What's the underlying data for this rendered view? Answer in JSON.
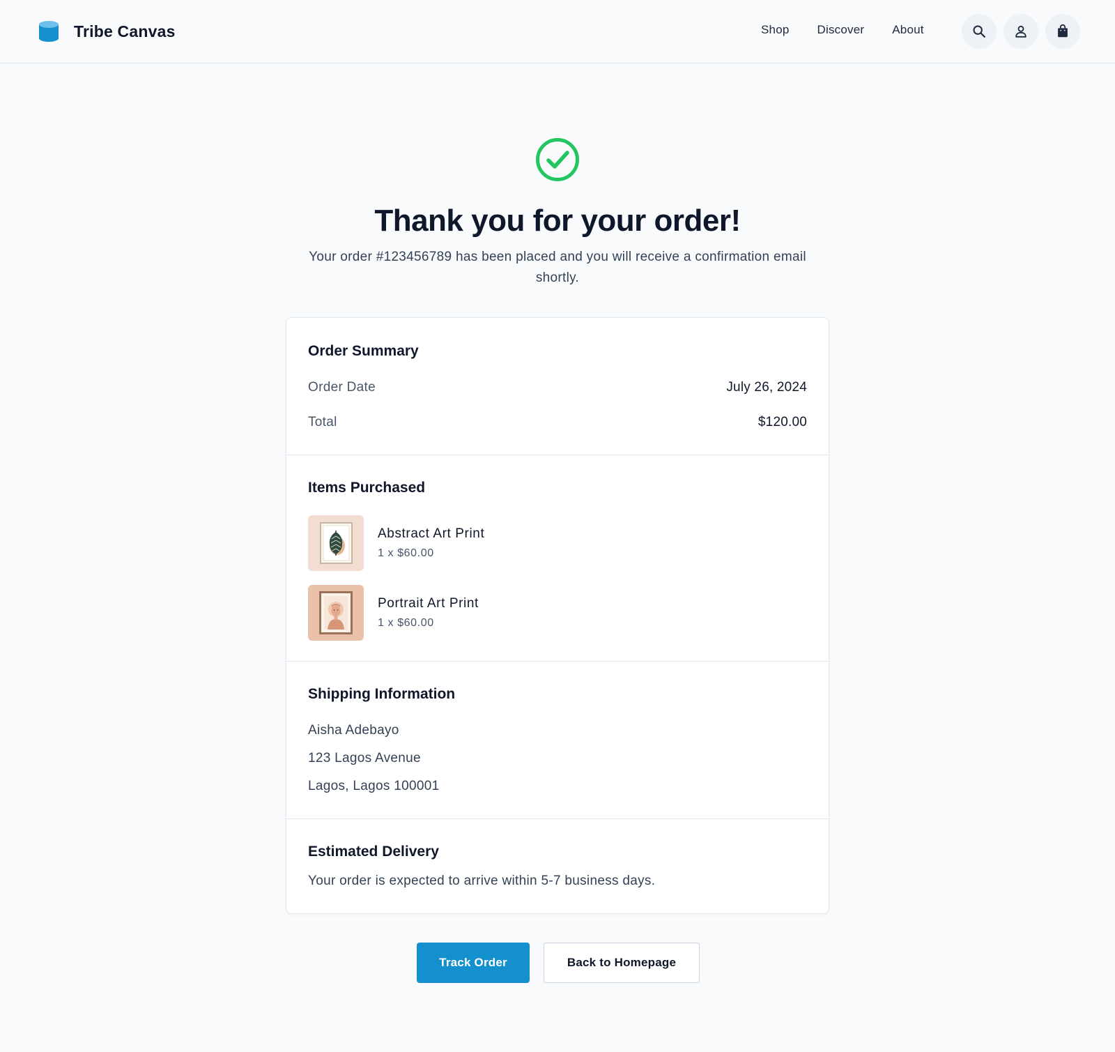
{
  "brand": {
    "name": "Tribe Canvas",
    "logo_icon": "cylinder-logo-icon",
    "accent_color": "#1590cf"
  },
  "nav": {
    "links": [
      "Shop",
      "Discover",
      "About"
    ],
    "icons": [
      "search-icon",
      "user-icon",
      "shopping-bag-icon"
    ]
  },
  "confirmation": {
    "icon": "check-circle-icon",
    "icon_color": "#22c55e",
    "title": "Thank you for your order!",
    "message": "Your order #123456789 has been placed and you will receive a confirmation email shortly."
  },
  "order_summary": {
    "heading": "Order Summary",
    "date_label": "Order Date",
    "date_value": "July 26, 2024",
    "total_label": "Total",
    "total_value": "$120.00"
  },
  "items_purchased": {
    "heading": "Items Purchased",
    "items": [
      {
        "name": "Abstract Art Print",
        "qty": "1 x $60.00",
        "thumbnail": "leaf-art-thumbnail"
      },
      {
        "name": "Portrait Art Print",
        "qty": "1 x $60.00",
        "thumbnail": "portrait-art-thumbnail"
      }
    ]
  },
  "shipping": {
    "heading": "Shipping Information",
    "name": "Aisha Adebayo",
    "street": "123 Lagos Avenue",
    "city": "Lagos, Lagos 100001"
  },
  "delivery": {
    "heading": "Estimated Delivery",
    "message": "Your order is expected to arrive within 5-7 business days."
  },
  "actions": {
    "primary": "Track Order",
    "secondary": "Back to Homepage"
  }
}
